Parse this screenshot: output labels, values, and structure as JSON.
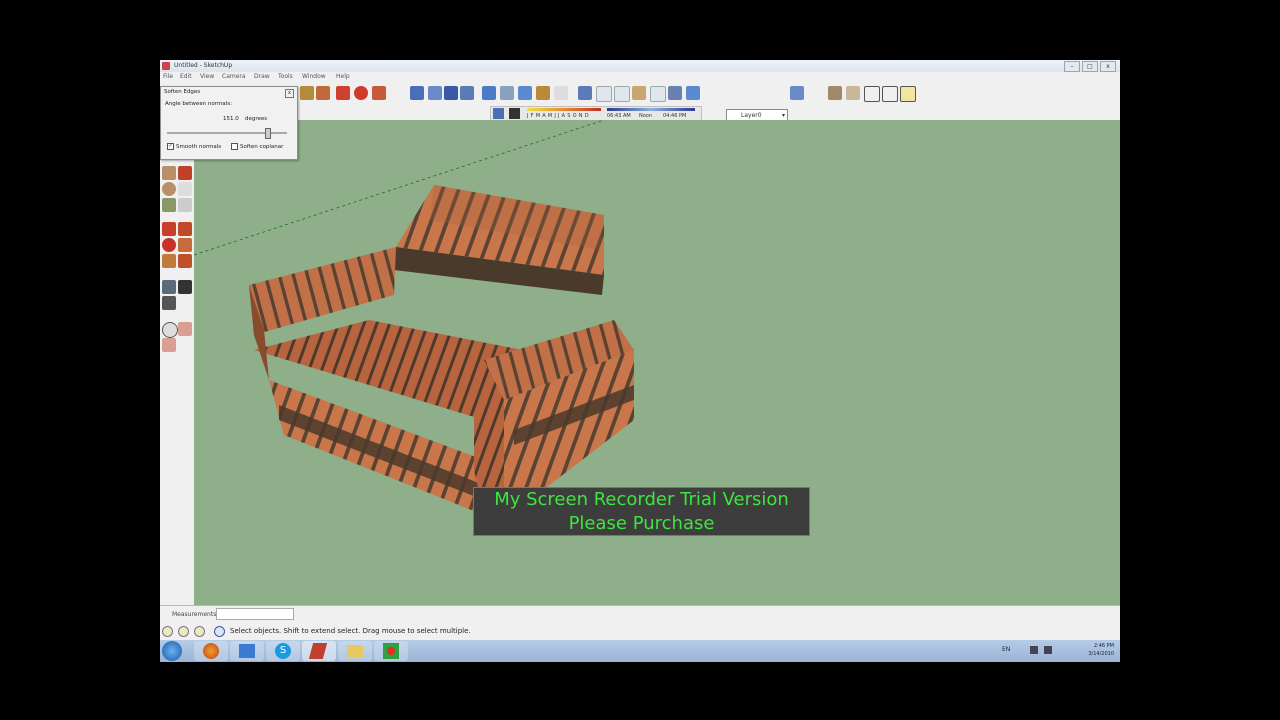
{
  "window": {
    "title": "Untitled - SketchUp",
    "controls": {
      "minimize": "–",
      "maximize": "□",
      "close": "x"
    }
  },
  "menu": [
    "File",
    "Edit",
    "View",
    "Camera",
    "Draw",
    "Tools",
    "Window",
    "Help"
  ],
  "shadow_bar": {
    "months": "J F M A M J J A S O N D",
    "time_start": "06:43 AM",
    "time_mid": "Noon",
    "time_end": "04:46 PM"
  },
  "layer_select": {
    "value": "Layer0"
  },
  "soften_dialog": {
    "title": "Soften Edges",
    "angle_label": "Angle between normals:",
    "angle_value": "151.0",
    "angle_unit": "degrees",
    "smooth_normals_label": "Smooth normals",
    "smooth_normals_checked": true,
    "soften_coplanar_label": "Soften coplanar",
    "soften_coplanar_checked": false
  },
  "measurements": {
    "label": "Measurements",
    "value": ""
  },
  "status": {
    "text": "Select objects. Shift to extend select. Drag mouse to select multiple."
  },
  "tray": {
    "lang": "EN",
    "time": "2:46 PM",
    "date": "3/14/2010"
  },
  "watermark": {
    "line1": "My Screen Recorder Trial Version",
    "line2": "Please Purchase",
    "color": "#3ee53e"
  },
  "colors": {
    "viewport": "#8fae8a",
    "couch": "#c8764a",
    "couch_dark": "#5a4332",
    "taskbar": "#a8c2e0"
  },
  "icons": {
    "taskbar": [
      "start-orb-icon",
      "firefox-icon",
      "explorer-icon",
      "skype-icon",
      "sketchup-icon",
      "folder-icon",
      "screen-recorder-icon"
    ]
  }
}
